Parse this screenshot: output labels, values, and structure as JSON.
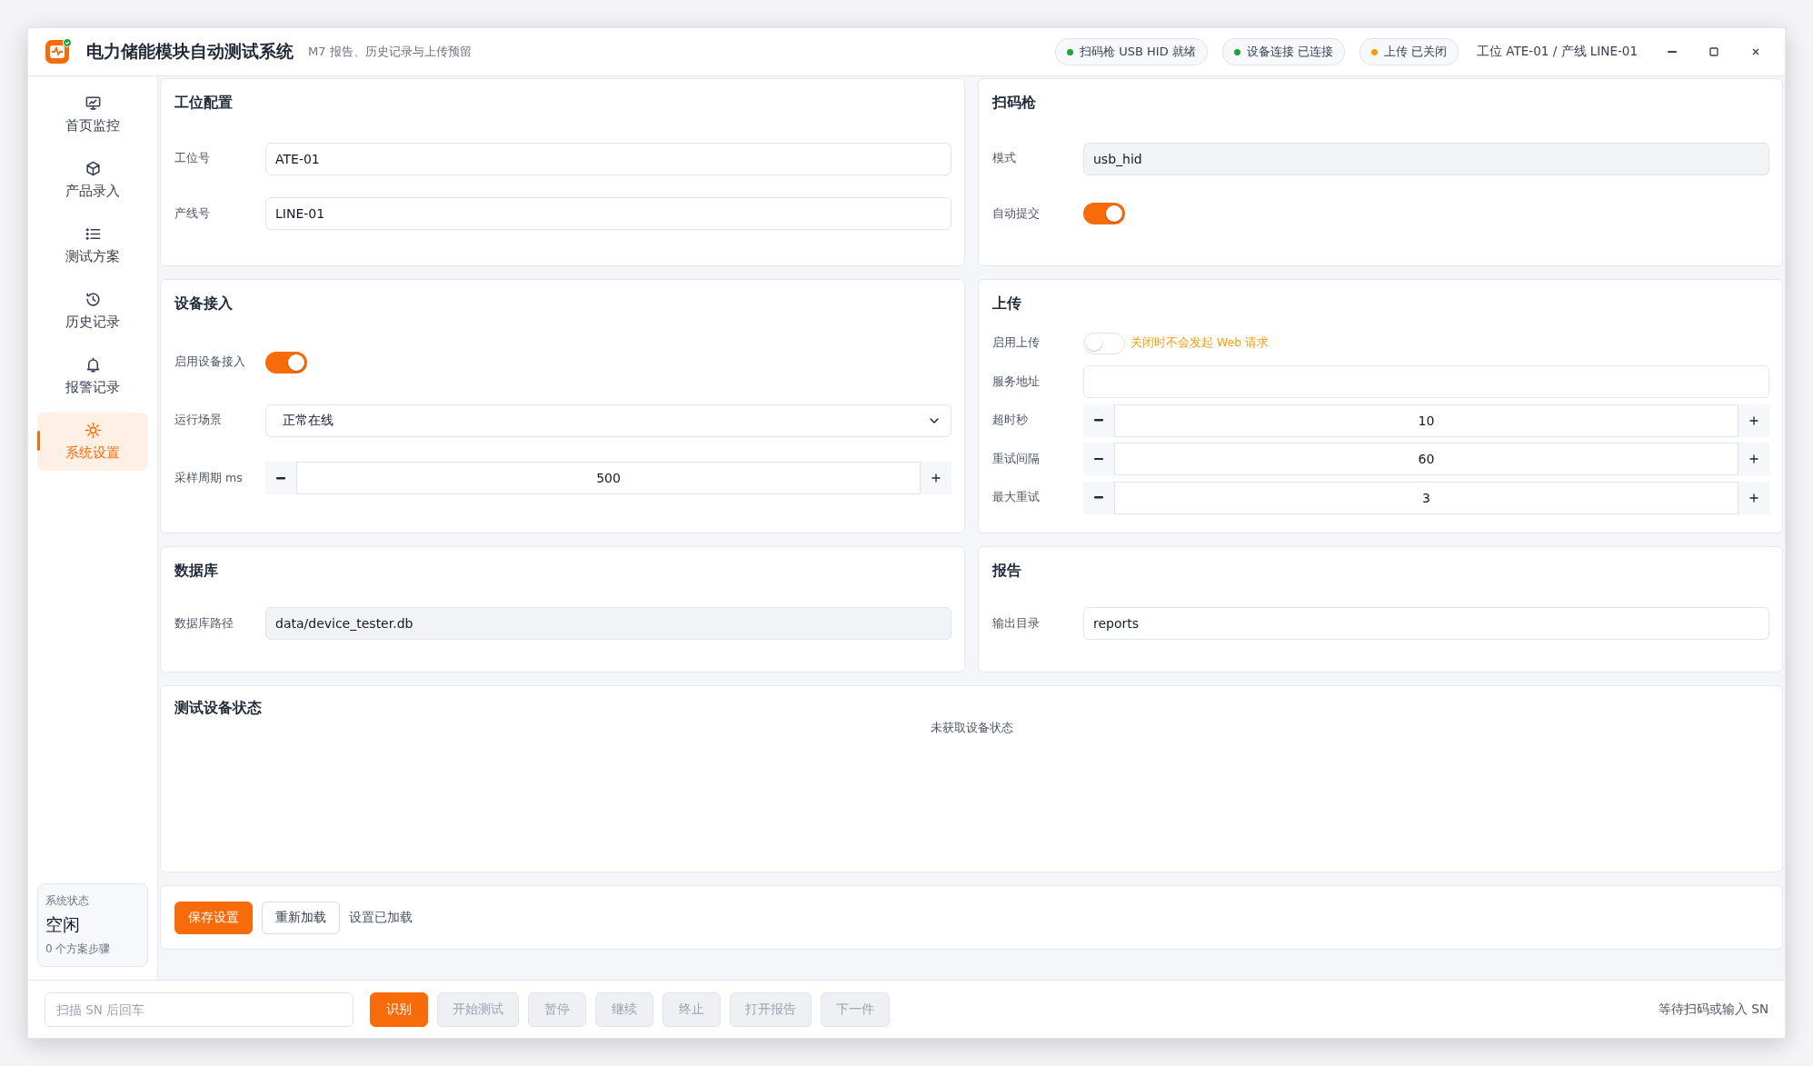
{
  "header": {
    "title": "电力储能模块自动测试系统",
    "subtitle": "M7 报告、历史记录与上传预留",
    "statuses": [
      {
        "label": "扫码枪 USB HID 就绪",
        "color": "#22a33a"
      },
      {
        "label": "设备连接 已连接",
        "color": "#22a33a"
      },
      {
        "label": "上传 已关闭",
        "color": "#f59e0b"
      }
    ],
    "station": "工位 ATE-01 / 产线 LINE-01"
  },
  "sidebar": {
    "items": [
      {
        "label": "首页监控",
        "selected": false
      },
      {
        "label": "产品录入",
        "selected": false
      },
      {
        "label": "测试方案",
        "selected": false
      },
      {
        "label": "历史记录",
        "selected": false
      },
      {
        "label": "报警记录",
        "selected": false
      },
      {
        "label": "系统设置",
        "selected": true
      }
    ],
    "status": {
      "label": "系统状态",
      "value": "空闲",
      "detail": "0 个方案步骤"
    }
  },
  "sections": [
    {
      "title": "工位配置",
      "fields": [
        {
          "kind": "text",
          "label": "工位号",
          "value": "ATE-01",
          "disabled": false
        },
        {
          "kind": "text",
          "label": "产线号",
          "value": "LINE-01",
          "disabled": false
        }
      ]
    },
    {
      "title": "扫码枪",
      "fields": [
        {
          "kind": "text",
          "label": "模式",
          "value": "usb_hid",
          "disabled": true
        },
        {
          "kind": "toggle",
          "label": "自动提交",
          "on": true
        }
      ]
    },
    {
      "title": "设备接入",
      "fields": [
        {
          "kind": "toggle",
          "label": "启用设备接入",
          "on": true
        },
        {
          "kind": "select",
          "label": "运行场景",
          "value": "正常在线"
        },
        {
          "kind": "stepper",
          "label": "采样周期 ms",
          "value": "500"
        }
      ]
    },
    {
      "title": "上传",
      "fields": [
        {
          "kind": "toggle",
          "label": "启用上传",
          "on": false,
          "hint": "关闭时不会发起 Web 请求"
        },
        {
          "kind": "text",
          "label": "服务地址",
          "disabled": false
        },
        {
          "kind": "stepper",
          "label": "超时秒",
          "value": "10"
        },
        {
          "kind": "stepper",
          "label": "重试间隔",
          "value": "60"
        },
        {
          "kind": "stepper",
          "label": "最大重试",
          "value": "3"
        }
      ]
    },
    {
      "title": "数据库",
      "fields": [
        {
          "kind": "text",
          "label": "数据库路径",
          "value": "data/device_tester.db",
          "disabled": true
        }
      ]
    },
    {
      "title": "报告",
      "fields": [
        {
          "kind": "text",
          "label": "输出目录",
          "value": "reports",
          "disabled": false
        }
      ]
    }
  ],
  "device_status": {
    "title": "测试设备状态",
    "empty": "未获取设备状态"
  },
  "actions": {
    "buttons": [
      {
        "label": "保存设置",
        "kind": "primary"
      },
      {
        "label": "重新加载",
        "kind": "secondary"
      }
    ],
    "message": "设置已加载"
  },
  "scan_bar": {
    "placeholder": "扫描 SN 后回车",
    "buttons": [
      {
        "label": "识别",
        "disabled": false
      },
      {
        "label": "开始测试",
        "disabled": true
      },
      {
        "label": "暂停",
        "disabled": true
      },
      {
        "label": "继续",
        "disabled": true
      },
      {
        "label": "终止",
        "disabled": true
      },
      {
        "label": "打开报告",
        "disabled": true
      },
      {
        "label": "下一件",
        "disabled": true
      }
    ],
    "status": "等待扫码或输入 SN"
  }
}
